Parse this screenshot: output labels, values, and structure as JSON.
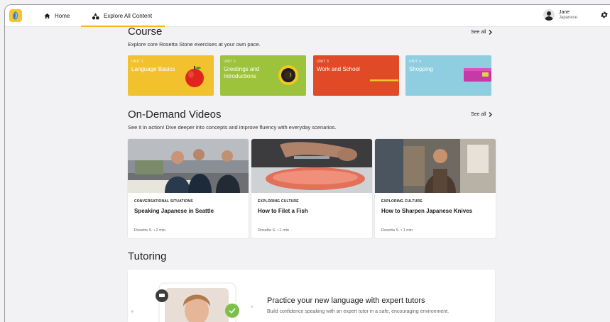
{
  "nav": {
    "home_label": "Home",
    "explore_label": "Explore All Content",
    "user_name": "Jane",
    "user_language": "Japanese"
  },
  "course": {
    "title": "Course",
    "subtitle": "Explore core Rosetta Stone exercises at your own pace.",
    "see_all": "See all",
    "units": [
      {
        "number": "UNIT 1",
        "title": "Language Basics",
        "color": "#f2c12e"
      },
      {
        "number": "UNIT 2",
        "title": "Greetings and Introductions",
        "color": "#9dc23b"
      },
      {
        "number": "UNIT 3",
        "title": "Work and School",
        "color": "#e04a26"
      },
      {
        "number": "UNIT 4",
        "title": "Shopping",
        "color": "#8fcde0"
      }
    ]
  },
  "videos": {
    "title": "On-Demand Videos",
    "subtitle": "See it in action! Dive deeper into concepts and improve fluency with everyday scenarios.",
    "see_all": "See all",
    "items": [
      {
        "category": "CONVERSATIONAL SITUATIONS",
        "title": "Speaking Japanese in Seattle",
        "meta": "Rosetta S. • 2 min"
      },
      {
        "category": "EXPLORING CULTURE",
        "title": "How to Filet a Fish",
        "meta": "Rosetta S. • 1 min"
      },
      {
        "category": "EXPLORING CULTURE",
        "title": "How to Sharpen Japanese Knives",
        "meta": "Rosetta S. • 1 min"
      }
    ]
  },
  "tutoring": {
    "title": "Tutoring",
    "card_title": "Practice your new language with expert tutors",
    "card_subtitle": "Build confidence speaking with an expert tutor in a safe, encouraging environment."
  },
  "colors": {
    "accent": "#f2b722",
    "background": "#f2f2f4"
  }
}
